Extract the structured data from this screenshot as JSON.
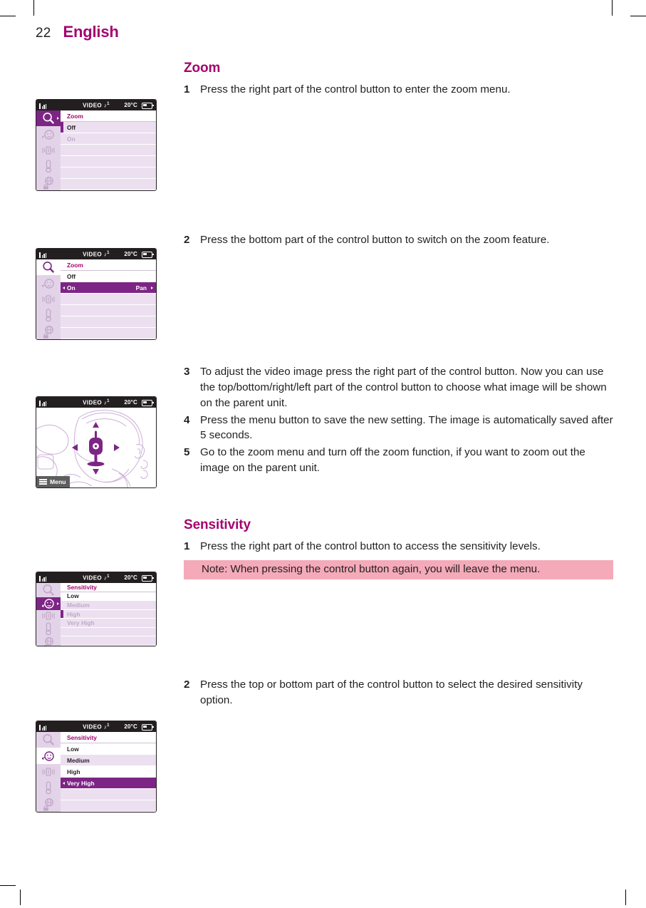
{
  "page": {
    "number": "22",
    "language": "English"
  },
  "sections": [
    {
      "title": "Zoom",
      "steps": [
        {
          "num": "1",
          "text": "Press the right part of the control button to enter the zoom menu."
        },
        {
          "num": "2",
          "text": "Press the bottom part of the control button to switch on the zoom feature."
        },
        {
          "num": "3",
          "text": "To adjust the video image press the right part of the control button. Now you can use the top/bottom/right/left part of the control button to choose what image will be shown on the parent unit."
        },
        {
          "num": "4",
          "text": "Press the menu button to save the new setting. The image is automatically saved after 5 seconds."
        },
        {
          "num": "5",
          "text": "Go to the zoom menu and turn off the zoom function, if you want to zoom out the image on the parent unit."
        }
      ]
    },
    {
      "title": "Sensitivity",
      "steps": [
        {
          "num": "1",
          "text": "Press the right part of the control button to access the sensitivity levels."
        },
        {
          "num": "2",
          "text": "Press the top or bottom part of the control button to select the desired sensitivity option."
        }
      ],
      "note": "Note: When pressing the control button again, you will leave the menu."
    }
  ],
  "status_bar": {
    "video_label": "VIDEO",
    "melody_note": "♪",
    "melody_number": "1",
    "temperature": "20°C"
  },
  "sidebar_icons": [
    {
      "name": "magnifier-icon",
      "label": "zoom"
    },
    {
      "name": "baby-face-icon",
      "label": "sensitivity"
    },
    {
      "name": "speaker-vibration-icon",
      "label": "sound"
    },
    {
      "name": "thermometer-icon",
      "label": "temperature"
    },
    {
      "name": "globe-lock-icon",
      "label": "network"
    }
  ],
  "screens": {
    "zoom_menu": {
      "header": "Zoom",
      "rows": [
        {
          "label": "Off",
          "state": "cursor"
        },
        {
          "label": "On",
          "state": "dim"
        }
      ]
    },
    "zoom_on": {
      "header": "Zoom",
      "rows": [
        {
          "label": "Off",
          "state": "normal"
        },
        {
          "label": "On",
          "state": "selected",
          "right_label": "Pan"
        }
      ]
    },
    "video_view": {
      "menu_button": "Menu"
    },
    "sensitivity_menu": {
      "header": "Sensitivity",
      "rows": [
        {
          "label": "Low",
          "state": "normal"
        },
        {
          "label": "Medium",
          "state": "dim"
        },
        {
          "label": "High",
          "state": "dim-cursor"
        },
        {
          "label": "Very High",
          "state": "dim"
        }
      ]
    },
    "sensitivity_selected": {
      "header": "Sensitivity",
      "rows": [
        {
          "label": "Low",
          "state": "normal"
        },
        {
          "label": "Medium",
          "state": "normal"
        },
        {
          "label": "High",
          "state": "normal"
        },
        {
          "label": "Very High",
          "state": "selected"
        }
      ]
    }
  },
  "colors": {
    "brand_magenta": "#a4036f",
    "menu_purple": "#7d2585",
    "row_lavender": "#ece0f0",
    "sidebar_lavender": "#e3d3e8",
    "note_pink": "#f4aab8",
    "status_black": "#231f20"
  }
}
